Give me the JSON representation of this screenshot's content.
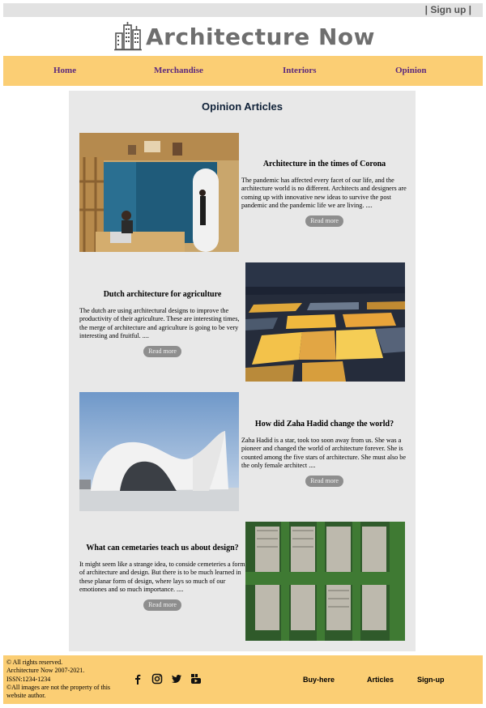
{
  "topbar": {
    "signup_label": "| Sign up |"
  },
  "brand": {
    "title": "Architecture Now",
    "logo_icon": "city-skyline-icon"
  },
  "nav": {
    "items": [
      {
        "label": "Home"
      },
      {
        "label": "Merchandise"
      },
      {
        "label": "Interiors"
      },
      {
        "label": "Opinion"
      }
    ]
  },
  "main": {
    "heading": "Opinion Articles",
    "read_more_label": "Read more",
    "articles": [
      {
        "title": "Architecture in the times of Corona",
        "text": "The pandemic has affected every facet of our life, and the architecture world is no different. Architects and designers are coming up with innovative new ideas to survive the post pandemic and the pandemic life we are living. ....",
        "image": "office-interior-photo"
      },
      {
        "title": "Dutch architecture for agriculture",
        "text": "The dutch are using architectural designs to improve the productivity of their agriculture. These are interesting times, the merge of architecture and agriculture is going to be very interesting and fruitful. ....",
        "image": "greenhouse-aerial-photo"
      },
      {
        "title": "How did Zaha Hadid change the world?",
        "text": "Zaha Hadid is a star, took too soon away from us. She was a pioneer and changed the world of architecture forever. She is counted among the five stars of architecture. She must also be the only female architect ....",
        "image": "heydar-aliyev-center-photo"
      },
      {
        "title": "What can cemetaries teach us about design?",
        "text": "It might seem like a strange idea, to conside cemeteries a form of architecture and design. But there is to be much learned in these planar form of design, where lays so much of our emotiones and so much importance. ....",
        "image": "cemetery-aerial-photo"
      }
    ]
  },
  "footer": {
    "lines": [
      "© All rights reserved.",
      "Architecture Now 2007-2021.",
      "ISSN:1234-1234",
      "©All images are not the property of this website author."
    ],
    "social_icons": [
      "facebook-icon",
      "instagram-icon",
      "twitter-icon",
      "youtube-icon"
    ],
    "links": [
      {
        "label": "Buy-here"
      },
      {
        "label": "Articles"
      },
      {
        "label": "Sign-up"
      }
    ]
  },
  "colors": {
    "accent": "#fbce74",
    "nav_text": "#5c2a7e",
    "panel": "#e8e8e8",
    "button": "#8e8e8e",
    "topbar": "#e2e2e2"
  }
}
